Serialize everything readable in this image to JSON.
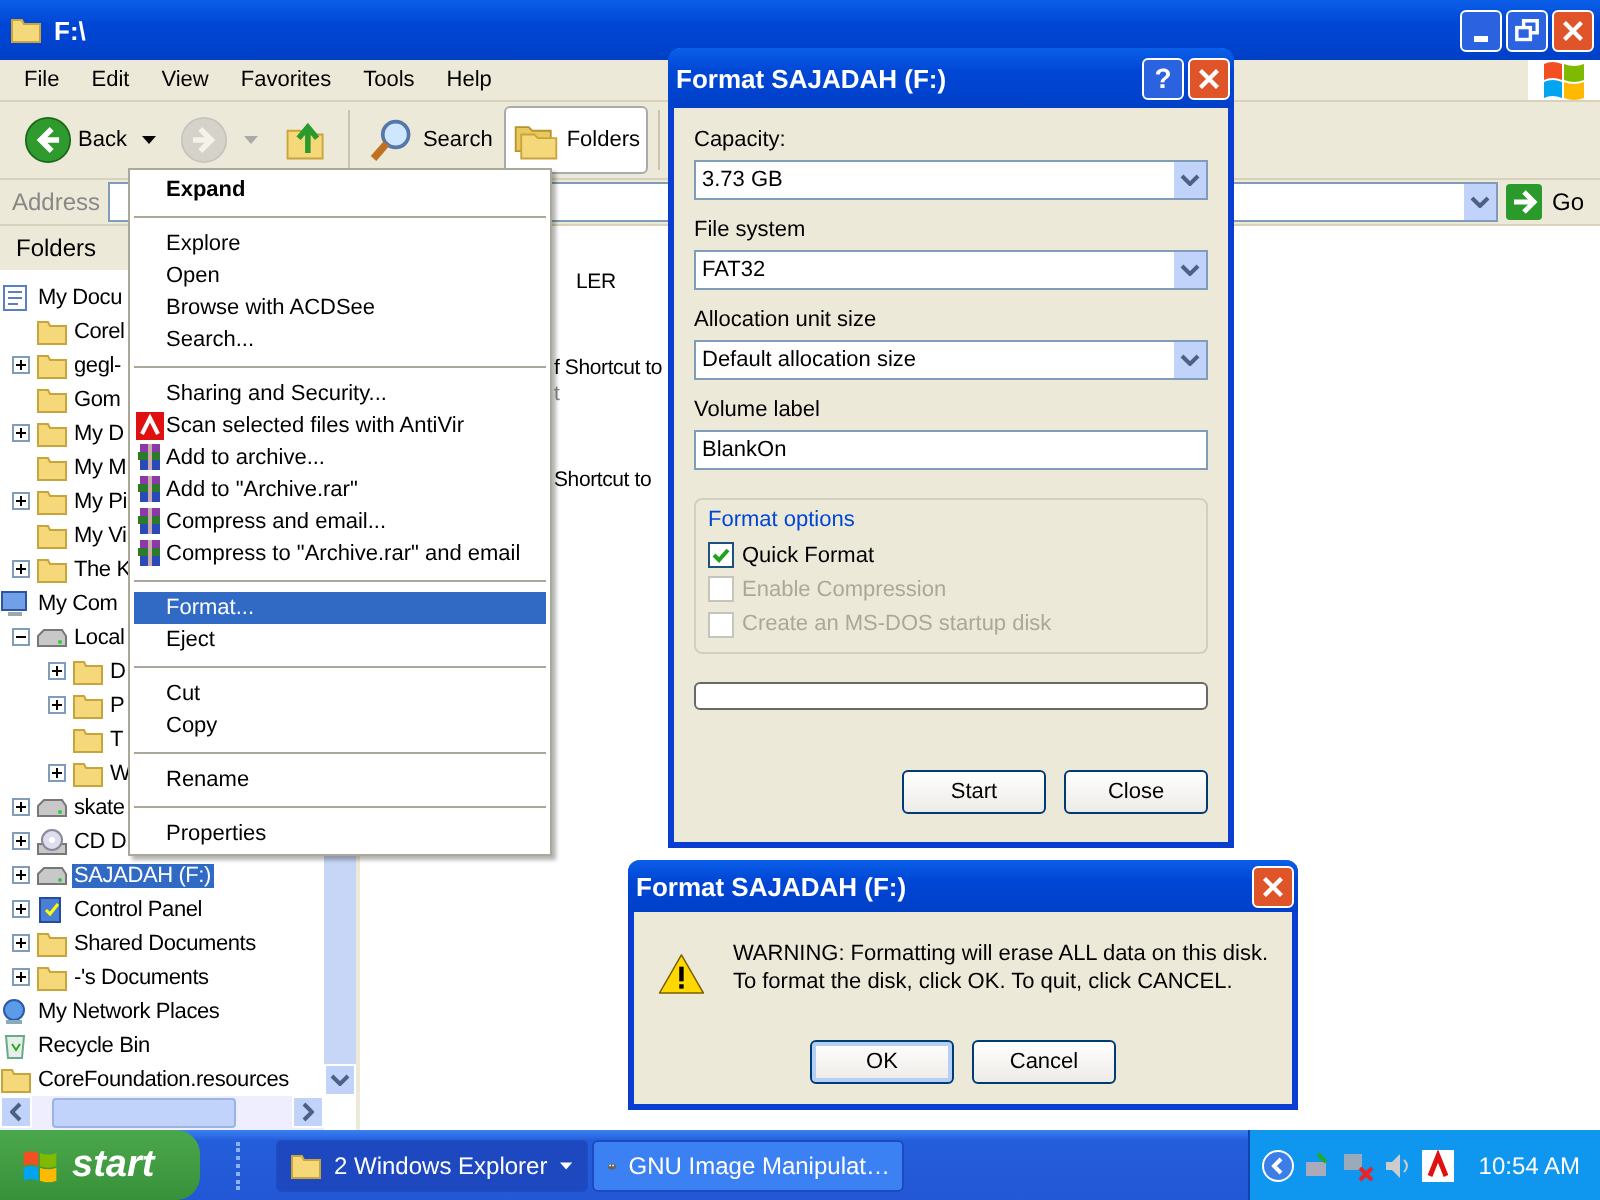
{
  "explorer": {
    "title": "F:\\",
    "menu": [
      "File",
      "Edit",
      "View",
      "Favorites",
      "Tools",
      "Help"
    ],
    "toolbar": [
      {
        "kind": "back",
        "label": "Back",
        "disabled": false,
        "selected": false
      },
      {
        "kind": "forward",
        "disabled": true,
        "selected": false
      },
      {
        "kind": "up",
        "disabled": false,
        "selected": false
      },
      {
        "kind": "search",
        "label": "Search",
        "disabled": false,
        "selected": false
      },
      {
        "kind": "folders",
        "label": "Folders",
        "disabled": false,
        "selected": true
      }
    ],
    "address": {
      "label": "Address",
      "go": "Go"
    },
    "folders_pane": {
      "title": "Folders",
      "tree": [
        {
          "label": "My Docu",
          "kind": "documents",
          "selected": false,
          "children": [
            {
              "label": "Corel",
              "kind": "folder",
              "selected": false
            },
            {
              "label": "gegl-",
              "kind": "folder",
              "expanded": false,
              "selected": false
            },
            {
              "label": "Gom",
              "kind": "folder",
              "selected": false
            },
            {
              "label": "My D",
              "kind": "folder",
              "expanded": false,
              "selected": false
            },
            {
              "label": "My M",
              "kind": "folder",
              "selected": false
            },
            {
              "label": "My Pi",
              "kind": "folder",
              "expanded": false,
              "selected": false
            },
            {
              "label": "My Vi",
              "kind": "folder",
              "selected": false
            },
            {
              "label": "The K",
              "kind": "folder",
              "expanded": false,
              "selected": false
            }
          ]
        },
        {
          "label": "My Com",
          "kind": "computer",
          "selected": false,
          "children": [
            {
              "label": "Local",
              "kind": "drive",
              "expanded": true,
              "selected": false,
              "children": [
                {
                  "label": "D",
                  "kind": "folder",
                  "expanded": false,
                  "selected": false
                },
                {
                  "label": "P",
                  "kind": "folder",
                  "expanded": false,
                  "selected": false
                },
                {
                  "label": "T",
                  "kind": "folder",
                  "selected": false
                },
                {
                  "label": "W",
                  "kind": "folder",
                  "expanded": false,
                  "selected": false
                }
              ]
            },
            {
              "label": "skate",
              "kind": "drive",
              "expanded": false,
              "selected": false
            },
            {
              "label": "CD D",
              "kind": "cd",
              "expanded": false,
              "selected": false
            },
            {
              "label": "SAJADAH (F:)",
              "kind": "drive",
              "expanded": false,
              "selected": true
            },
            {
              "label": "Control Panel",
              "kind": "panel",
              "expanded": false,
              "selected": false
            },
            {
              "label": "Shared Documents",
              "kind": "folder",
              "expanded": false,
              "selected": false
            },
            {
              "label": "-'s Documents",
              "kind": "folder",
              "expanded": false,
              "selected": false
            }
          ]
        },
        {
          "label": "My Network Places",
          "kind": "network",
          "selected": false
        },
        {
          "label": "Recycle Bin",
          "kind": "recycle",
          "selected": false
        },
        {
          "label": "CoreFoundation.resources",
          "kind": "folder",
          "selected": false
        }
      ]
    },
    "file_list": [
      {
        "label": "LER",
        "dimmed": false
      },
      {
        "label": "f Shortcut to",
        "dimmed": false
      },
      {
        "label": "t",
        "dimmed": true
      },
      {
        "label": "Shortcut to",
        "dimmed": false
      }
    ]
  },
  "context_menu": [
    {
      "kind": "plain",
      "label": "Expand",
      "bold": true,
      "selected": false
    },
    {
      "kind": "separator"
    },
    {
      "kind": "plain",
      "label": "Explore",
      "bold": false,
      "selected": false
    },
    {
      "kind": "plain",
      "label": "Open",
      "bold": false,
      "selected": false
    },
    {
      "kind": "plain",
      "label": "Browse with ACDSee",
      "bold": false,
      "selected": false
    },
    {
      "kind": "plain",
      "label": "Search...",
      "bold": false,
      "selected": false
    },
    {
      "kind": "separator"
    },
    {
      "kind": "plain",
      "label": "Sharing and Security...",
      "bold": false,
      "selected": false
    },
    {
      "kind": "antivir",
      "label": "Scan selected files with AntiVir",
      "bold": false,
      "selected": false
    },
    {
      "kind": "archive",
      "label": "Add to archive...",
      "bold": false,
      "selected": false
    },
    {
      "kind": "archive",
      "label": "Add to \"Archive.rar\"",
      "bold": false,
      "selected": false
    },
    {
      "kind": "archive",
      "label": "Compress and email...",
      "bold": false,
      "selected": false
    },
    {
      "kind": "archive",
      "label": "Compress to \"Archive.rar\" and email",
      "bold": false,
      "selected": false
    },
    {
      "kind": "separator"
    },
    {
      "kind": "plain",
      "label": "Format...",
      "bold": false,
      "selected": true
    },
    {
      "kind": "plain",
      "label": "Eject",
      "bold": false,
      "selected": false
    },
    {
      "kind": "separator"
    },
    {
      "kind": "plain",
      "label": "Cut",
      "bold": false,
      "selected": false
    },
    {
      "kind": "plain",
      "label": "Copy",
      "bold": false,
      "selected": false
    },
    {
      "kind": "separator"
    },
    {
      "kind": "plain",
      "label": "Rename",
      "bold": false,
      "selected": false
    },
    {
      "kind": "separator"
    },
    {
      "kind": "plain",
      "label": "Properties",
      "bold": false,
      "selected": false
    }
  ],
  "format_dialog": {
    "title": "Format SAJADAH (F:)",
    "help": "?",
    "fields": [
      {
        "label": "Capacity:",
        "value": "3.73 GB"
      },
      {
        "label": "File system",
        "value": "FAT32"
      },
      {
        "label": "Allocation unit size",
        "value": "Default allocation size"
      }
    ],
    "volume_label": {
      "label": "Volume label",
      "value": "BlankOn"
    },
    "options": {
      "title": "Format options",
      "items": [
        {
          "label": "Quick Format",
          "checked": true,
          "disabled": false
        },
        {
          "label": "Enable Compression",
          "checked": false,
          "disabled": true
        },
        {
          "label": "Create an MS-DOS startup disk",
          "checked": false,
          "disabled": true
        }
      ]
    },
    "progress": {
      "level": 0
    },
    "buttons": [
      "Start",
      "Close"
    ]
  },
  "warning_dialog": {
    "title": "Format SAJADAH (F:)",
    "lines": [
      "WARNING: Formatting will erase ALL data on this disk.",
      "To format the disk, click OK. To quit, click CANCEL."
    ],
    "buttons": [
      {
        "label": "OK",
        "selected": true
      },
      {
        "label": "Cancel",
        "selected": false
      }
    ]
  },
  "taskbar": {
    "start": "start",
    "tasks": [
      {
        "kind": "explorer",
        "label": "2 Windows Explorer",
        "group": true,
        "selected": true
      },
      {
        "kind": "gimp",
        "label": "GNU Image Manipulat…",
        "group": false,
        "selected": false
      }
    ],
    "clock": "10:54 AM"
  }
}
